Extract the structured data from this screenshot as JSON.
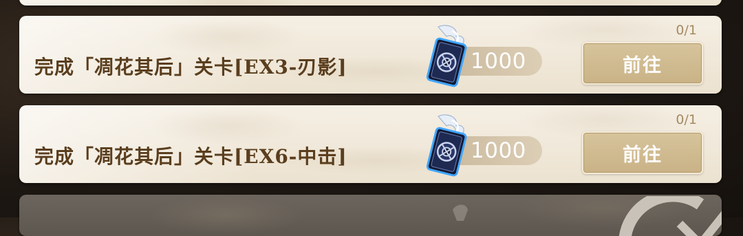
{
  "quest_list": {
    "items": [
      {
        "task": "完成「凋花其后」关卡[EX3-刃影]",
        "progress": "0/1",
        "reward_icon": "card-token-icon",
        "reward_amount": "1000",
        "action_label": "前往"
      },
      {
        "task": "完成「凋花其后」关卡[EX6-中击]",
        "progress": "0/1",
        "reward_icon": "card-token-icon",
        "reward_amount": "1000",
        "action_label": "前往"
      }
    ]
  },
  "colors": {
    "card_bg": "#f0e8d8",
    "task_text": "#5a3e1e",
    "progress_text": "#a48a62",
    "button_bg": "#d2bd93",
    "button_text": "#ffffff",
    "completed_card_bg": "#645e57"
  }
}
